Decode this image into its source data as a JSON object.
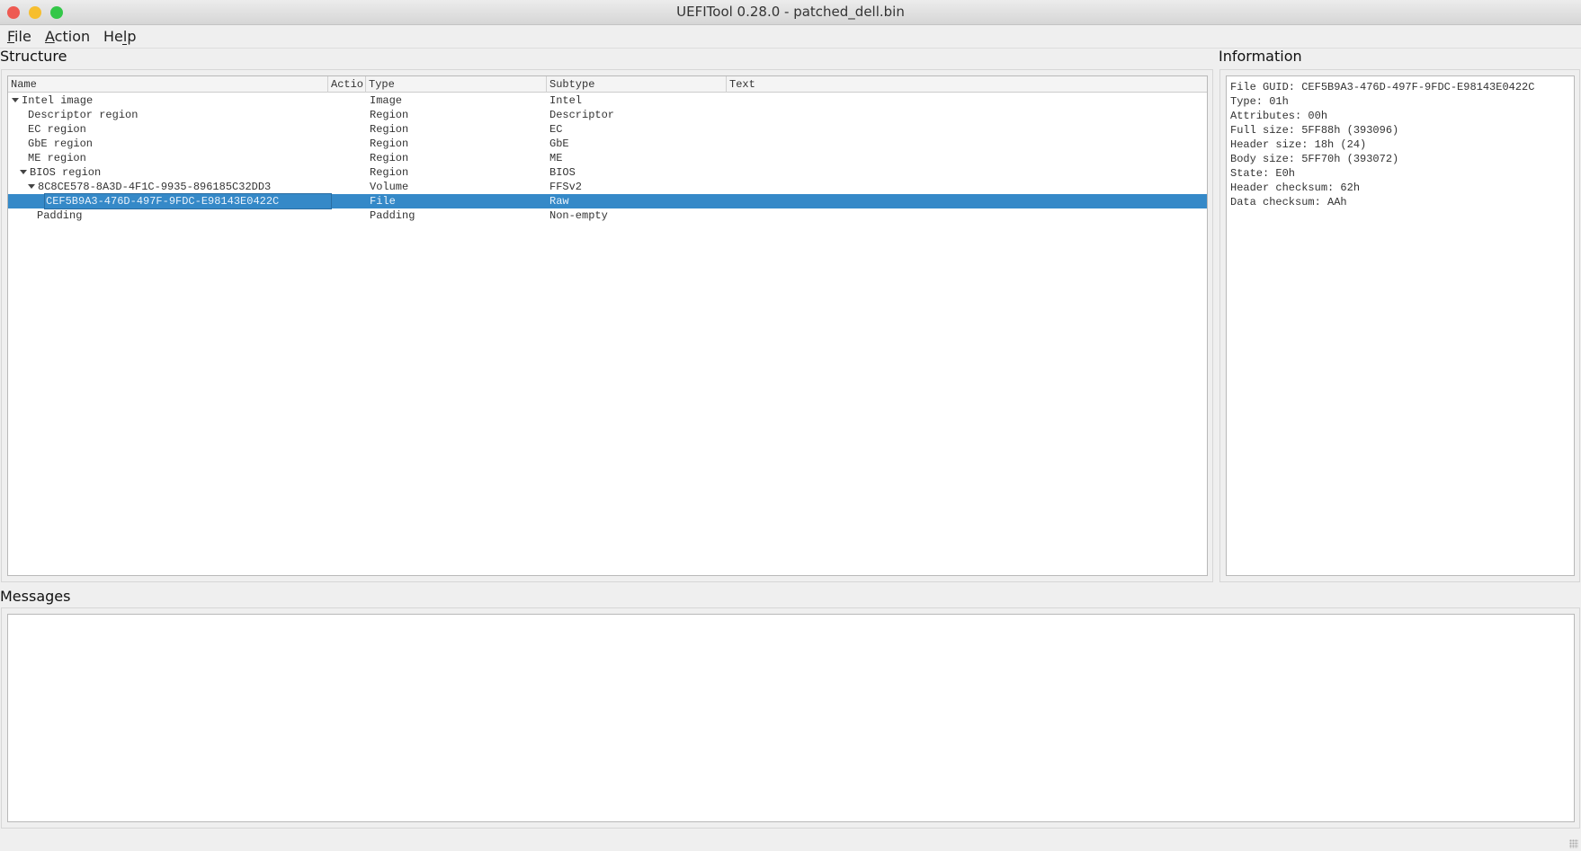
{
  "window": {
    "title": "UEFITool 0.28.0 - patched_dell.bin"
  },
  "menu": [
    {
      "label": "File",
      "mn": "F",
      "rest": "ile"
    },
    {
      "label": "Action",
      "mn": "A",
      "rest": "ction"
    },
    {
      "label": "Help",
      "pre": "He",
      "mn": "l",
      "rest": "p"
    }
  ],
  "structure": {
    "title": "Structure",
    "columns": [
      "Name",
      "Actio",
      "Type",
      "Subtype",
      "Text"
    ],
    "rows": [
      {
        "name": "Intel image",
        "type": "Image",
        "subtype": "Intel",
        "text": ""
      },
      {
        "name": "Descriptor region",
        "type": "Region",
        "subtype": "Descriptor",
        "text": ""
      },
      {
        "name": "EC region",
        "type": "Region",
        "subtype": "EC",
        "text": ""
      },
      {
        "name": "GbE region",
        "type": "Region",
        "subtype": "GbE",
        "text": ""
      },
      {
        "name": "ME region",
        "type": "Region",
        "subtype": "ME",
        "text": ""
      },
      {
        "name": "BIOS region",
        "type": "Region",
        "subtype": "BIOS",
        "text": ""
      },
      {
        "name": "8C8CE578-8A3D-4F1C-9935-896185C32DD3",
        "type": "Volume",
        "subtype": "FFSv2",
        "text": ""
      },
      {
        "name": "CEF5B9A3-476D-497F-9FDC-E98143E0422C",
        "type": "File",
        "subtype": "Raw",
        "text": ""
      },
      {
        "name": "Padding",
        "type": "Padding",
        "subtype": "Non-empty",
        "text": ""
      }
    ]
  },
  "information": {
    "title": "Information",
    "lines": [
      "File GUID: CEF5B9A3-476D-497F-9FDC-E98143E0422C",
      "Type: 01h",
      "Attributes: 00h",
      "Full size: 5FF88h (393096)",
      "Header size: 18h (24)",
      "Body size: 5FF70h (393072)",
      "State: E0h",
      "Header checksum: 62h",
      "Data checksum: AAh"
    ]
  },
  "messages": {
    "title": "Messages"
  },
  "colors": {
    "selection": "#3589c8"
  }
}
